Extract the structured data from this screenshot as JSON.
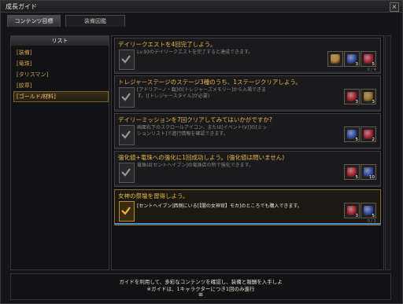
{
  "window": {
    "title": "成長ガイド",
    "close_glyph": "×"
  },
  "tabs": [
    {
      "label": "コンテンツ目標"
    },
    {
      "label": "装備図鑑"
    }
  ],
  "list": {
    "header": "リスト",
    "items": [
      {
        "label": "[装備]",
        "selected": false
      },
      {
        "label": "[竜珠]",
        "selected": false
      },
      {
        "label": "[タリスマン]",
        "selected": false
      },
      {
        "label": "[紋章]",
        "selected": false
      },
      {
        "label": "[ゴールド/材料]",
        "selected": true
      }
    ]
  },
  "tasks": [
    {
      "title": "デイリークエストを4回完了しよう。",
      "desc": "Lv.93のデイリークエストを完了すると達成できます。",
      "progress": "0 / 4",
      "completed": false,
      "bar": 0,
      "rewards": [
        {
          "icon": "gold-pouch-icon",
          "count": "",
          "color": "#b8842c"
        },
        {
          "icon": "blue-dragon-orb-icon",
          "count": "3",
          "color": "#3a56b8"
        },
        {
          "icon": "red-gem-icon",
          "count": "5",
          "color": "#b82a3a"
        }
      ]
    },
    {
      "title": "トレジャーステージのステージ3種のうち、1ステージクリアしよう。",
      "desc": "[アドリアーノ・臨]の[トレジャーズメモリー]から入場できます。([トレジャースタイル]が必要)",
      "progress": "",
      "completed": false,
      "bar": 0,
      "rewards": [
        {
          "icon": "red-gem-icon",
          "count": "3",
          "color": "#b82a3a"
        },
        {
          "icon": "gold-box-icon",
          "count": "3",
          "color": "#a07a2c"
        }
      ]
    },
    {
      "title": "デイリーミッションを7回クリアしてみてはいかがですか?",
      "desc": "画面右下のスクロールアイコン、または[イベント(V)]の[ミッションリスト]で進行情報を確認できます。",
      "progress": "",
      "completed": false,
      "bar": 0,
      "rewards": [
        {
          "icon": "blue-dragon-orb-icon",
          "count": "5",
          "color": "#3a56b8"
        },
        {
          "icon": "red-gem-icon",
          "count": "2",
          "color": "#b82a3a"
        }
      ]
    },
    {
      "title": "強化値+竜珠への強化に1回成功しよう。(強化値は問いません)",
      "desc": "竜珠は[セントヘイブン]の竜珠店の所で強化できます。",
      "progress": "",
      "completed": false,
      "bar": 0,
      "rewards": [
        {
          "icon": "red-gem-icon",
          "count": "5",
          "color": "#b82a3a"
        },
        {
          "icon": "blue-dragon-orb-icon",
          "count": "10",
          "color": "#3a56b8"
        }
      ]
    },
    {
      "title": "女神の祭壇を習得しよう。",
      "desc": "[セントヘイブン]西側にいる[【闇の女神官】モカ]のところでも購入できます。",
      "progress": "0 / 1",
      "completed": true,
      "bar": 1,
      "rewards": [
        {
          "icon": "red-gem-icon",
          "count": "3",
          "color": "#b82a3a"
        },
        {
          "icon": "blue-dragon-orb-icon",
          "count": "5",
          "color": "#3a56b8"
        }
      ]
    }
  ],
  "footer": {
    "line1": "ガイドを利用して、多彩なコンテンツを確認し、装備と報酬を入手しよ",
    "line2": "※ガイドは、1キャラクターにつき1回のみ進行",
    "glyph": "⊞"
  }
}
